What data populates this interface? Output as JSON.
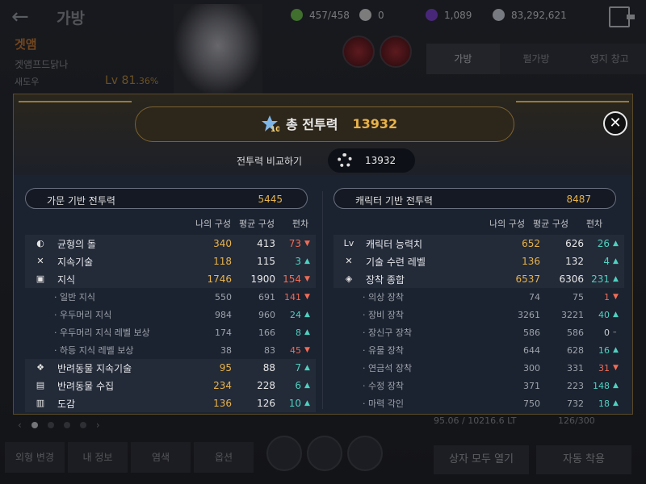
{
  "top": {
    "title": "가방",
    "currencies": [
      {
        "icon": "stamina-icon",
        "value": "457/458",
        "color": "#6cc24a"
      },
      {
        "icon": "pearl-icon",
        "value": "0",
        "color": "#d9d9d9"
      },
      {
        "icon": "crystal-icon",
        "value": "1,089",
        "color": "#7b3fd1"
      },
      {
        "icon": "silver-icon",
        "value": "83,292,621",
        "color": "#cfd6df"
      }
    ]
  },
  "character": {
    "name": "겟앰",
    "guild": "겟앰프드닭나",
    "class": "새도우",
    "level": "Lv 81",
    "level_pct": ".36%"
  },
  "bg_tabs": [
    "가방",
    "펄가방",
    "영지 창고"
  ],
  "bottom": {
    "buttons": [
      "외형 변경",
      "내 정보",
      "염색",
      "옵션"
    ],
    "weight": "95.06 / 10216.6 LT",
    "slots": "126/300",
    "open_all": "상자 모두 열기",
    "auto_apply": "자동 착용"
  },
  "modal": {
    "title": "총 전투력",
    "total": "13932",
    "badge": "10",
    "compare_label": "전투력 비교하기",
    "compare_value": "13932",
    "col_my": "나의 구성",
    "col_avg": "평균 구성",
    "col_diff": "편차",
    "left": {
      "title": "가문 기반 전투력",
      "total": "5445",
      "rows": [
        {
          "type": "main",
          "icon": "balance-stone-icon",
          "icon_text": "◐",
          "label": "균형의 돌",
          "my": "340",
          "avg": "413",
          "diff": "73",
          "dir": "down"
        },
        {
          "type": "main",
          "icon": "skill-icon",
          "icon_text": "✕",
          "label": "지속기술",
          "my": "118",
          "avg": "115",
          "diff": "3",
          "dir": "up"
        },
        {
          "type": "main",
          "icon": "knowledge-icon",
          "icon_text": "▣",
          "label": "지식",
          "my": "1746",
          "avg": "1900",
          "diff": "154",
          "dir": "down"
        },
        {
          "type": "sub",
          "label": "· 일반 지식",
          "my": "550",
          "avg": "691",
          "diff": "141",
          "dir": "down"
        },
        {
          "type": "sub",
          "label": "· 우두머리 지식",
          "my": "984",
          "avg": "960",
          "diff": "24",
          "dir": "up"
        },
        {
          "type": "sub",
          "label": "· 우두머리 지식 레벨 보상",
          "my": "174",
          "avg": "166",
          "diff": "8",
          "dir": "up"
        },
        {
          "type": "sub",
          "label": "· 하등 지식 레벨 보상",
          "my": "38",
          "avg": "83",
          "diff": "45",
          "dir": "down"
        },
        {
          "type": "main",
          "icon": "pet-paw-icon",
          "icon_text": "❖",
          "label": "반려동물 지속기술",
          "my": "95",
          "avg": "88",
          "diff": "7",
          "dir": "up"
        },
        {
          "type": "main",
          "icon": "pet-collection-icon",
          "icon_text": "▤",
          "label": "반려동물 수집",
          "my": "234",
          "avg": "228",
          "diff": "6",
          "dir": "up"
        },
        {
          "type": "main",
          "icon": "codex-icon",
          "icon_text": "▥",
          "label": "도감",
          "my": "136",
          "avg": "126",
          "diff": "10",
          "dir": "up"
        }
      ]
    },
    "right": {
      "title": "캐릭터 기반 전투력",
      "total": "8487",
      "rows": [
        {
          "type": "main",
          "icon": "level-icon",
          "icon_text": "Lv",
          "label": "캐릭터 능력치",
          "my": "652",
          "avg": "626",
          "diff": "26",
          "dir": "up"
        },
        {
          "type": "main",
          "icon": "skill-train-icon",
          "icon_text": "✕",
          "label": "기술 수련 레벨",
          "my": "136",
          "avg": "132",
          "diff": "4",
          "dir": "up"
        },
        {
          "type": "main",
          "icon": "equipment-icon",
          "icon_text": "◈",
          "label": "장착 종합",
          "my": "6537",
          "avg": "6306",
          "diff": "231",
          "dir": "up"
        },
        {
          "type": "sub",
          "label": "· 의상 장착",
          "my": "74",
          "avg": "75",
          "diff": "1",
          "dir": "down"
        },
        {
          "type": "sub",
          "label": "· 장비 장착",
          "my": "3261",
          "avg": "3221",
          "diff": "40",
          "dir": "up"
        },
        {
          "type": "sub",
          "label": "· 장신구 장착",
          "my": "586",
          "avg": "586",
          "diff": "0",
          "dir": "neutral"
        },
        {
          "type": "sub",
          "label": "· 유물 장착",
          "my": "644",
          "avg": "628",
          "diff": "16",
          "dir": "up"
        },
        {
          "type": "sub",
          "label": "· 연금석 장착",
          "my": "300",
          "avg": "331",
          "diff": "31",
          "dir": "down"
        },
        {
          "type": "sub",
          "label": "· 수정 장착",
          "my": "371",
          "avg": "223",
          "diff": "148",
          "dir": "up"
        },
        {
          "type": "sub",
          "label": "· 마력 각인",
          "my": "750",
          "avg": "732",
          "diff": "18",
          "dir": "up"
        }
      ]
    }
  },
  "arrows": {
    "up": "▲",
    "down": "▼",
    "neutral": "–"
  }
}
